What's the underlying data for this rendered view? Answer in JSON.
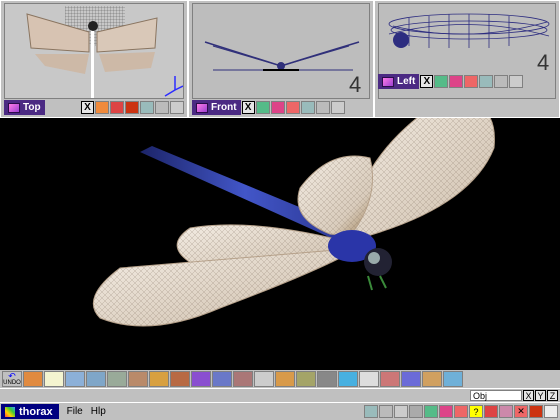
{
  "viewports": {
    "top": {
      "label": "Top",
      "close_label": "X"
    },
    "front": {
      "label": "Front",
      "close_label": "X",
      "corner_number": "4"
    },
    "left": {
      "label": "Left",
      "close_label": "X",
      "corner_number": "4"
    }
  },
  "toolbar": {
    "undo_label": "UNDO",
    "tools": [
      "cube-icon",
      "light-icon",
      "select-icon",
      "rotate-icon",
      "grid-icon",
      "texture-icon",
      "palette-icon",
      "sphere-icon",
      "torus-icon",
      "lathe-icon",
      "extrude-icon",
      "path-icon",
      "hinge-icon",
      "plane-icon",
      "stack-icon",
      "figure-icon",
      "animate-icon",
      "bones-icon",
      "grid-mesh-icon",
      "render-icon",
      "camera-icon"
    ]
  },
  "status": {
    "obj_field": "Obj",
    "axes": [
      "X",
      "Y",
      "Z"
    ]
  },
  "menubar": {
    "app_name": "thorax",
    "menus": [
      "File",
      "Hlp"
    ]
  },
  "colors": {
    "title_bar": "#000080",
    "tag": "#4b2a83",
    "panel": "#c0c0c0"
  }
}
